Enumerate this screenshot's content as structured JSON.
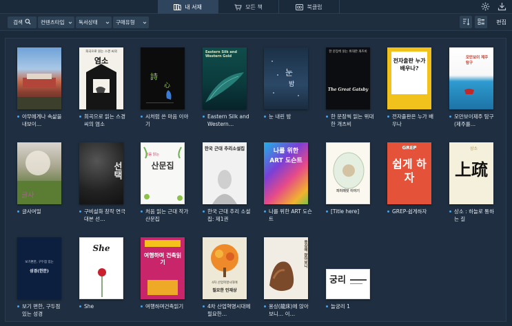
{
  "tabs": [
    {
      "label": "내 서재",
      "icon": "bookshelf-icon",
      "active": true
    },
    {
      "label": "모든 책",
      "icon": "cart-icon",
      "active": false
    },
    {
      "label": "북클럽",
      "icon": "bookclub-icon",
      "active": false
    }
  ],
  "top_icons": [
    "settings-icon",
    "download-icon"
  ],
  "toolbar": {
    "search_label": "검색",
    "filters": [
      "컨텐츠타입",
      "독서상태",
      "구매유형"
    ],
    "edit_label": "편집"
  },
  "books": [
    {
      "title": "아무에게나 속삶을 내보이…",
      "cover_title": "",
      "cover_text": ""
    },
    {
      "title": "희곡으로 읽는 스경 씨의 염소",
      "cover_title": "염소",
      "cover_text": "희곡으로 읽는 스경 씨의"
    },
    {
      "title": "시처럼 쓴 마음 이야기",
      "cover_title": "",
      "cover_text": ""
    },
    {
      "title": "Eastern Silk and Western…",
      "cover_title": "Eastern Silk and Western Gold",
      "cover_text": ""
    },
    {
      "title": "눈 내린 밤",
      "cover_title": "눈 내린 밤",
      "cover_text": ""
    },
    {
      "title": "한 문장씩 읽는 위대한 개츠비",
      "cover_title": "The Great Gatsby",
      "cover_text": "한 문장씩 읽는 위대한 개츠비"
    },
    {
      "title": "전자출판은 누가 배우나",
      "cover_title": "전자출판 누가 배우나?",
      "cover_text": ""
    },
    {
      "title": "모만보이제주 탐구(제주를…",
      "cover_title": "모만보이 제주탐구",
      "cover_text": ""
    },
    {
      "title": "글사여밀",
      "cover_title": "",
      "cover_text": ""
    },
    {
      "title": "구비설화 창작 연극대본 선…",
      "cover_title": "선택",
      "cover_text": ""
    },
    {
      "title": "처음 읽는 근대 작가 산문집",
      "cover_title": "산문집",
      "cover_text": "처음 읽는"
    },
    {
      "title": "한국 근대 추리 소설집: 제1권",
      "cover_title": "한국 근대 추리소설집",
      "cover_text": ""
    },
    {
      "title": "나를 위한 ART 도슨트",
      "cover_title": "나를 위한 ART 도슨트",
      "cover_text": ""
    },
    {
      "title": "[Title here]",
      "cover_title": "피터래빗 이야기",
      "cover_text": ""
    },
    {
      "title": "GREP-쉽게하자",
      "cover_title": "쉽게 하자",
      "cover_text": "GREP"
    },
    {
      "title": "상소 : 하늘로 통하는 길",
      "cover_title": "上疏",
      "cover_text": "상소"
    },
    {
      "title": "보기 편한, 구두점 있는 성경",
      "cover_title": "성경(한문)",
      "cover_text": "보기편한, 구두점 있는"
    },
    {
      "title": "She",
      "cover_title": "She",
      "cover_text": ""
    },
    {
      "title": "여행하며건축읽기",
      "cover_title": "여행하며 건축읽기",
      "cover_text": ""
    },
    {
      "title": "4차 산업혁명시대에 필요한…",
      "cover_title": "필요한 인재상",
      "cover_text": "4차 산업혁명시대에"
    },
    {
      "title": "용상(龍床)에 앉아보니… 이…",
      "cover_title": "용상에 앉아보니",
      "cover_text": ""
    },
    {
      "title": "늘궁리 1",
      "cover_title": "궁리",
      "cover_text": ""
    }
  ]
}
